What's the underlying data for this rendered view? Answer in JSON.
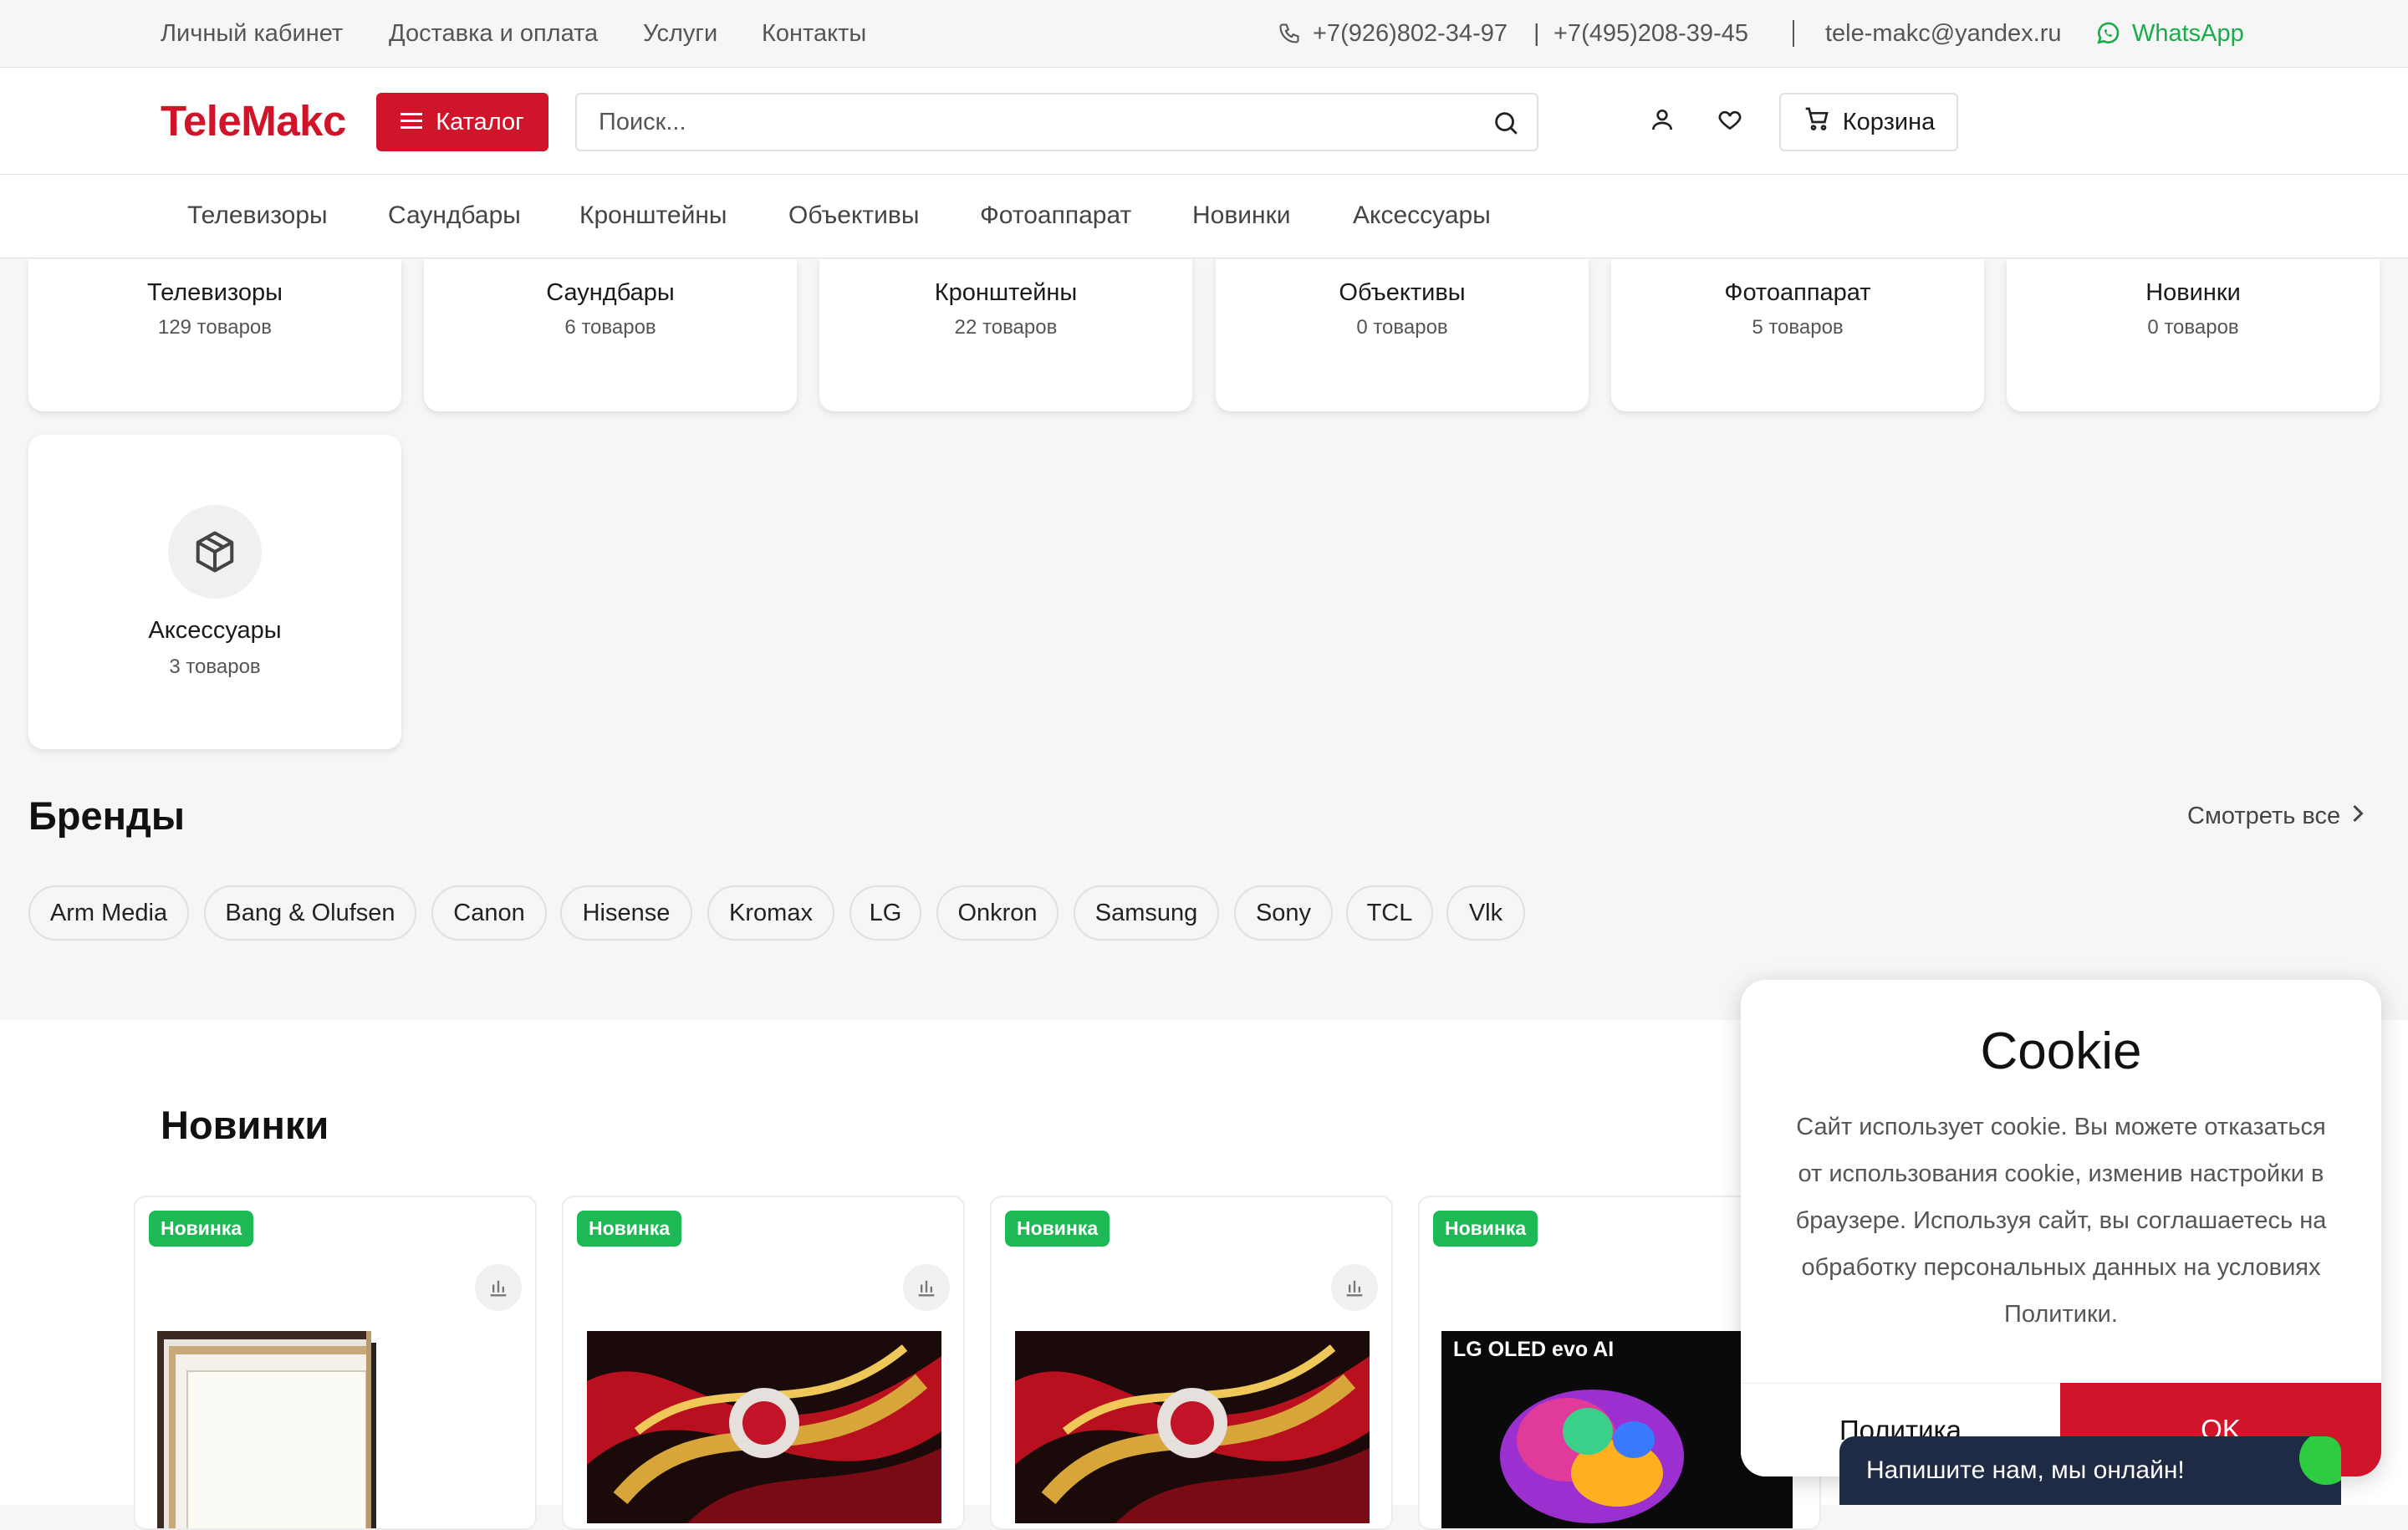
{
  "topbar": {
    "links": [
      "Личный кабинет",
      "Доставка и оплата",
      "Услуги",
      "Контакты"
    ],
    "phone1": "+7(926)802-34-97",
    "sep": "|",
    "phone2": "+7(495)208-39-45",
    "email": "tele-makc@yandex.ru",
    "whatsapp": "WhatsApp"
  },
  "header": {
    "logo": "TeleMakc",
    "catalog_label": "Каталог",
    "search_placeholder": "Поиск...",
    "cart_label": "Корзина"
  },
  "nav": [
    "Телевизоры",
    "Саундбары",
    "Кронштейны",
    "Объективы",
    "Фотоаппарат",
    "Новинки",
    "Аксессуары"
  ],
  "categories": [
    {
      "name": "Телевизоры",
      "count": "129 товаров"
    },
    {
      "name": "Саундбары",
      "count": "6 товаров"
    },
    {
      "name": "Кронштейны",
      "count": "22 товаров"
    },
    {
      "name": "Объективы",
      "count": "0 товаров"
    },
    {
      "name": "Фотоаппарат",
      "count": "5 товаров"
    },
    {
      "name": "Новинки",
      "count": "0 товаров"
    },
    {
      "name": "Аксессуары",
      "count": "3 товаров"
    }
  ],
  "brands": {
    "title": "Бренды",
    "see_all": "Смотреть все",
    "items": [
      "Arm Media",
      "Bang & Olufsen",
      "Canon",
      "Hisense",
      "Kromax",
      "LG",
      "Onkron",
      "Samsung",
      "Sony",
      "TCL",
      "Vlk"
    ]
  },
  "new_products": {
    "title": "Новинки",
    "badge": "Новинка",
    "lg_brand_text": "LG OLED evo AI"
  },
  "cookie": {
    "title": "Cookie",
    "text": "Сайт использует cookie. Вы можете отказаться от использования cookie, изменив настройки в браузере. Используя сайт, вы соглашаетесь на обработку персональных данных на условиях Политики.",
    "policy_button": "Политика",
    "ok_button": "OK"
  },
  "chat": {
    "text": "Напишите нам, мы онлайн!"
  },
  "colors": {
    "accent": "#d0152a",
    "whatsapp": "#1aab4b",
    "badge": "#1db954",
    "chat": "#1f2a44"
  }
}
